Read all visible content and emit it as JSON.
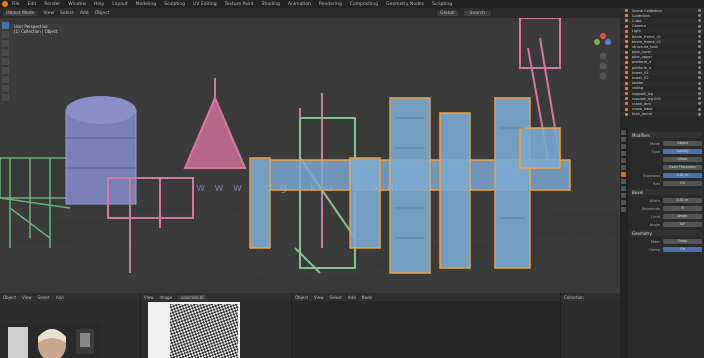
{
  "top_menu": {
    "items": [
      "File",
      "Edit",
      "Render",
      "Window",
      "Help",
      "Layout",
      "Modeling",
      "Sculpting",
      "UV Editing",
      "Texture Paint",
      "Shading",
      "Animation",
      "Rendering",
      "Compositing",
      "Geometry Nodes",
      "Scripting"
    ]
  },
  "viewport": {
    "header_items": [
      "Object Mode",
      "View",
      "Select",
      "Add",
      "Object"
    ],
    "header_right": [
      "Global",
      "Search"
    ],
    "info_line1": "User Perspective",
    "info_line2": "(1) Collection | Object",
    "watermark": "w w w . c g - k u . c o m"
  },
  "outliner": {
    "rows": [
      "Scene Collection",
      "Collection",
      "Cube",
      "Camera",
      "Light",
      "beam_frame_01",
      "beam_frame_02",
      "structure_tank",
      "pipe_lower",
      "pipe_upper",
      "platform_a",
      "platform_b",
      "tower_01",
      "tower_02",
      "ladder",
      "railing",
      "support_leg",
      "support_leg.001",
      "crane_arm",
      "crane_base",
      "tank_dome"
    ]
  },
  "properties": {
    "section1": "Modifiers",
    "rows1": [
      {
        "label": "Mode",
        "value": "Object"
      },
      {
        "label": "Type",
        "value": "Solidify"
      },
      {
        "label": "",
        "value": "Offset"
      },
      {
        "label": "",
        "value": "Even Thickness"
      },
      {
        "label": "Thickness",
        "value": "0.02 m"
      },
      {
        "label": "Rim",
        "value": "Fill"
      }
    ],
    "section2": "Bevel",
    "rows2": [
      {
        "label": "Width",
        "value": "0.01 m"
      },
      {
        "label": "Segments",
        "value": "3"
      },
      {
        "label": "Limit",
        "value": "Angle"
      },
      {
        "label": "Angle",
        "value": "30°"
      }
    ],
    "section3": "Geometry",
    "rows3": [
      {
        "label": "Miter",
        "value": "Sharp"
      },
      {
        "label": "Clamp",
        "value": "On"
      }
    ]
  },
  "bottom": {
    "ed1_items": [
      "Object",
      "View",
      "Select",
      "Add"
    ],
    "ed2_items": [
      "View",
      "Image",
      "concrete.tif"
    ],
    "ed3_items": [
      "Object",
      "View",
      "Select",
      "Add",
      "Node"
    ],
    "ed4_items": [
      "Collection"
    ]
  }
}
